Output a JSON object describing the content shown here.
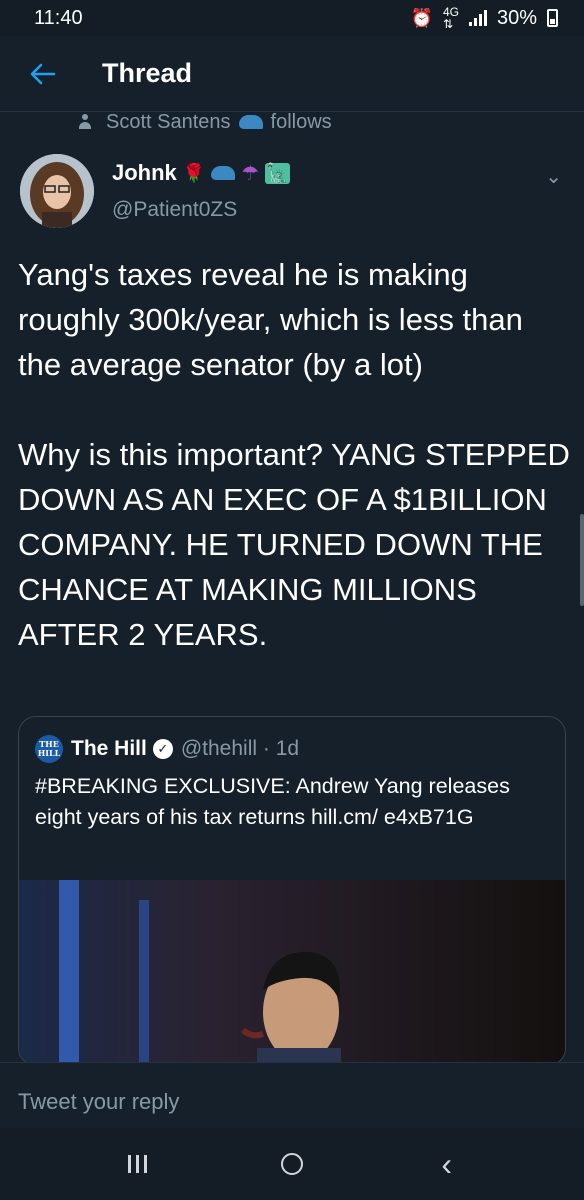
{
  "status_bar": {
    "time": "11:40",
    "battery": "30%",
    "alarm_icon": "alarm-icon",
    "signal_icon": "signal-icon",
    "battery_icon": "battery-icon"
  },
  "header": {
    "title": "Thread",
    "back_icon": "arrow-left-icon"
  },
  "social_context": {
    "name": "Scott Santens",
    "suffix": "follows"
  },
  "tweet": {
    "author_name": "Johnk",
    "author_emojis": [
      "🌹",
      "🧢",
      "☂",
      "🗽"
    ],
    "author_handle": "@Patient0ZS",
    "text": "Yang's taxes reveal he is making roughly 300k/year, which is less than the average senator (by a lot)\n\nWhy is this important? YANG STEPPED DOWN AS AN EXEC OF A $1BILLION COMPANY. HE TURNED DOWN THE CHANCE AT MAKING MILLIONS AFTER 2 YEARS."
  },
  "quoted_tweet": {
    "logo_text": "THE HILL",
    "name": "The Hill",
    "handle_time": "@thehill · 1d",
    "text": "#BREAKING EXCLUSIVE: Andrew Yang releases eight years of his tax returns hill.cm/ e4xB71G"
  },
  "reply": {
    "placeholder": "Tweet your reply"
  },
  "colors": {
    "background": "#15202b",
    "accent": "#1da1f2",
    "secondary_text": "#8899a6",
    "border": "#38444d"
  }
}
